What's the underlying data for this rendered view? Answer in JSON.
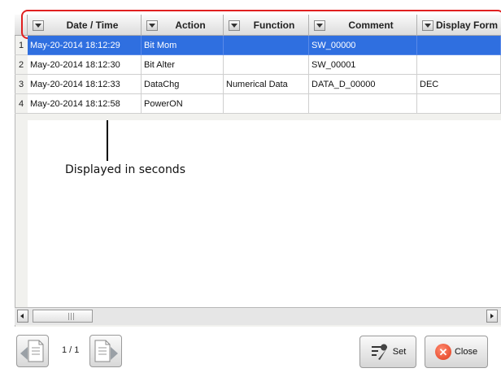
{
  "table": {
    "columns": [
      {
        "label": "Date / Time"
      },
      {
        "label": "Action"
      },
      {
        "label": "Function"
      },
      {
        "label": "Comment"
      },
      {
        "label": "Display Form"
      }
    ],
    "rows": [
      {
        "num": "1",
        "datetime": "May-20-2014 18:12:29",
        "action": "Bit Mom",
        "function": "",
        "comment": "SW_00000",
        "display": ""
      },
      {
        "num": "2",
        "datetime": "May-20-2014 18:12:30",
        "action": "Bit Alter",
        "function": "",
        "comment": "SW_00001",
        "display": ""
      },
      {
        "num": "3",
        "datetime": "May-20-2014 18:12:33",
        "action": "DataChg",
        "function": "Numerical Data",
        "comment": "DATA_D_00000",
        "display": "DEC"
      },
      {
        "num": "4",
        "datetime": "May-20-2014 18:12:58",
        "action": "PowerON",
        "function": "",
        "comment": "",
        "display": ""
      }
    ],
    "selected_row": 1
  },
  "annotation": {
    "text": "Displayed in seconds"
  },
  "footer": {
    "page_info": "1 / 1",
    "set_label": "Set",
    "close_label": "Close"
  },
  "colors": {
    "selection": "#2f6fe0",
    "highlight_box": "#e02020",
    "close_icon": "#e03a1a"
  }
}
